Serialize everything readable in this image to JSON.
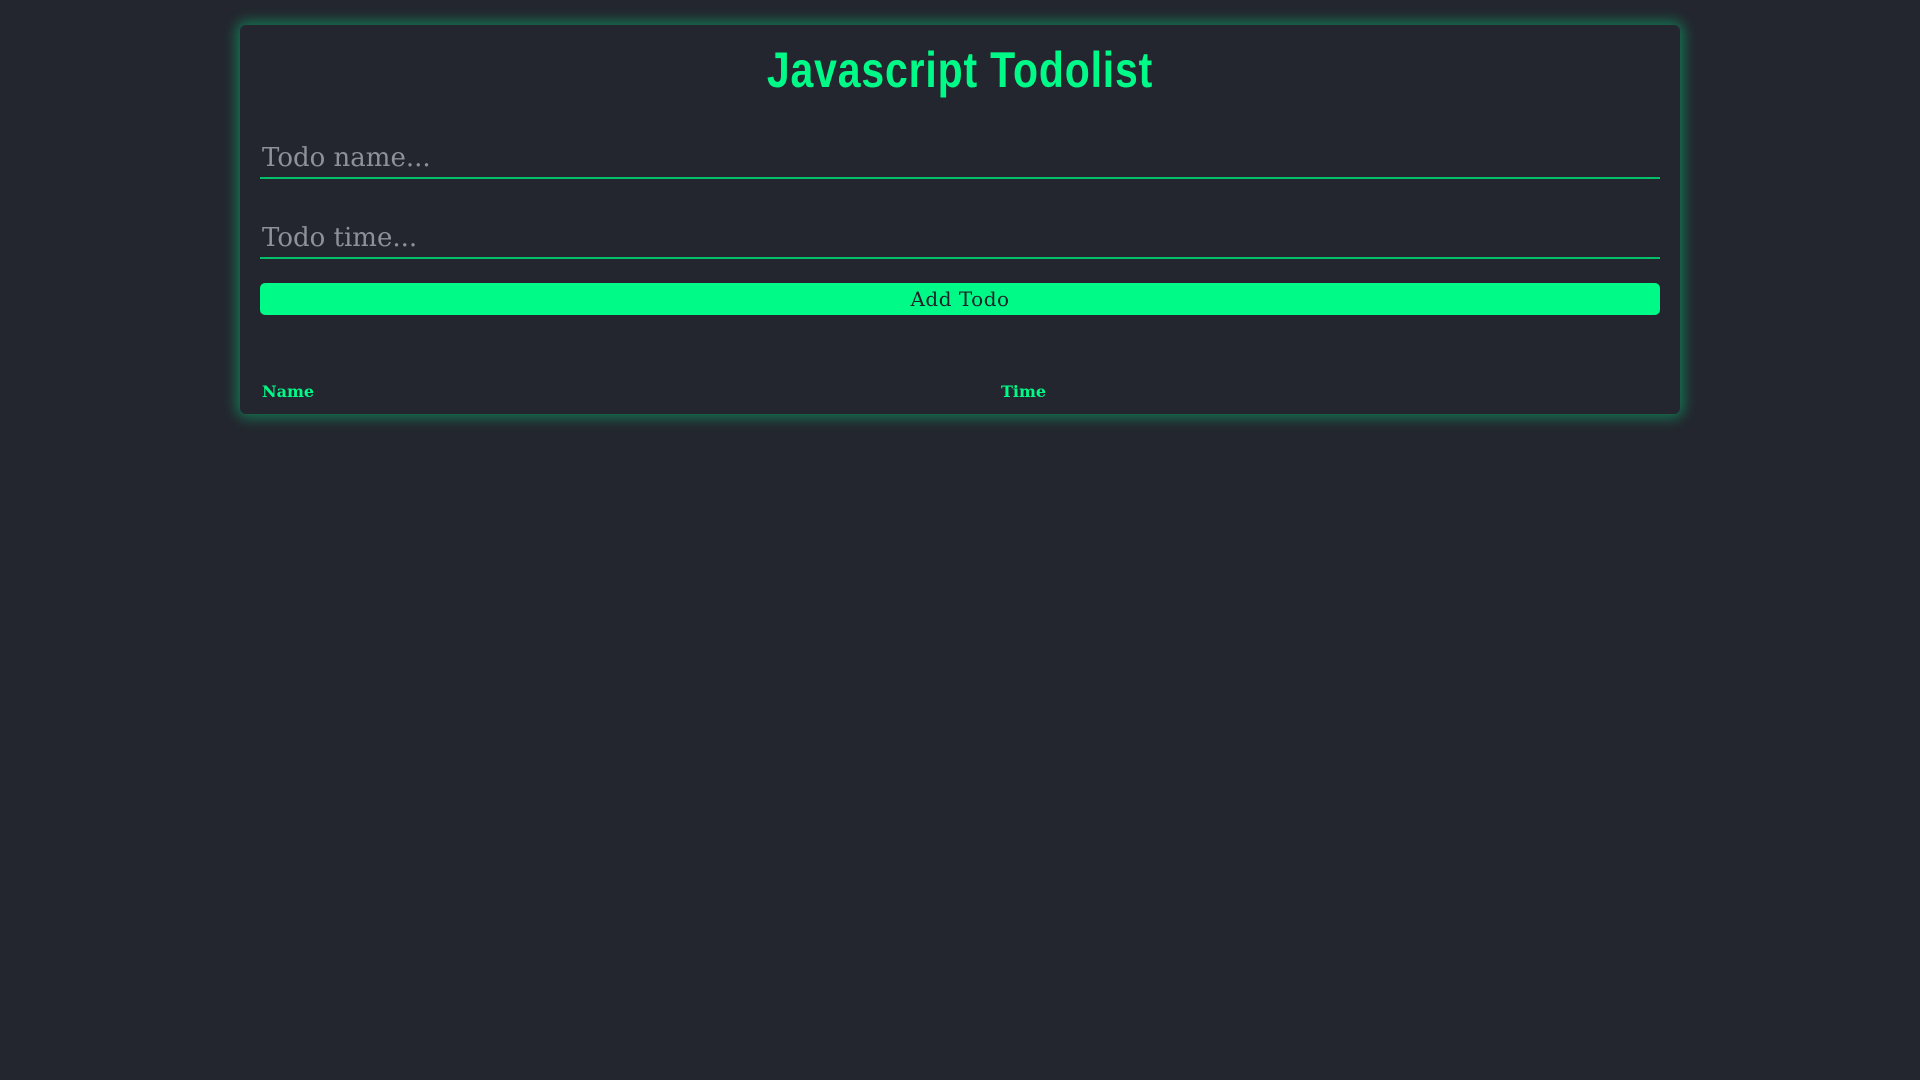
{
  "app": {
    "title": "Javascript Todolist"
  },
  "form": {
    "name_input": {
      "value": "",
      "placeholder": "Todo name..."
    },
    "time_input": {
      "value": "",
      "placeholder": "Todo time..."
    },
    "add_button_label": "Add Todo"
  },
  "todo_list": {
    "columns": [
      "Name",
      "Time"
    ],
    "rows": []
  },
  "colors": {
    "accent": "#00fa87",
    "background": "#23262f",
    "button_text": "#1e2128",
    "placeholder": "#8d919a"
  }
}
